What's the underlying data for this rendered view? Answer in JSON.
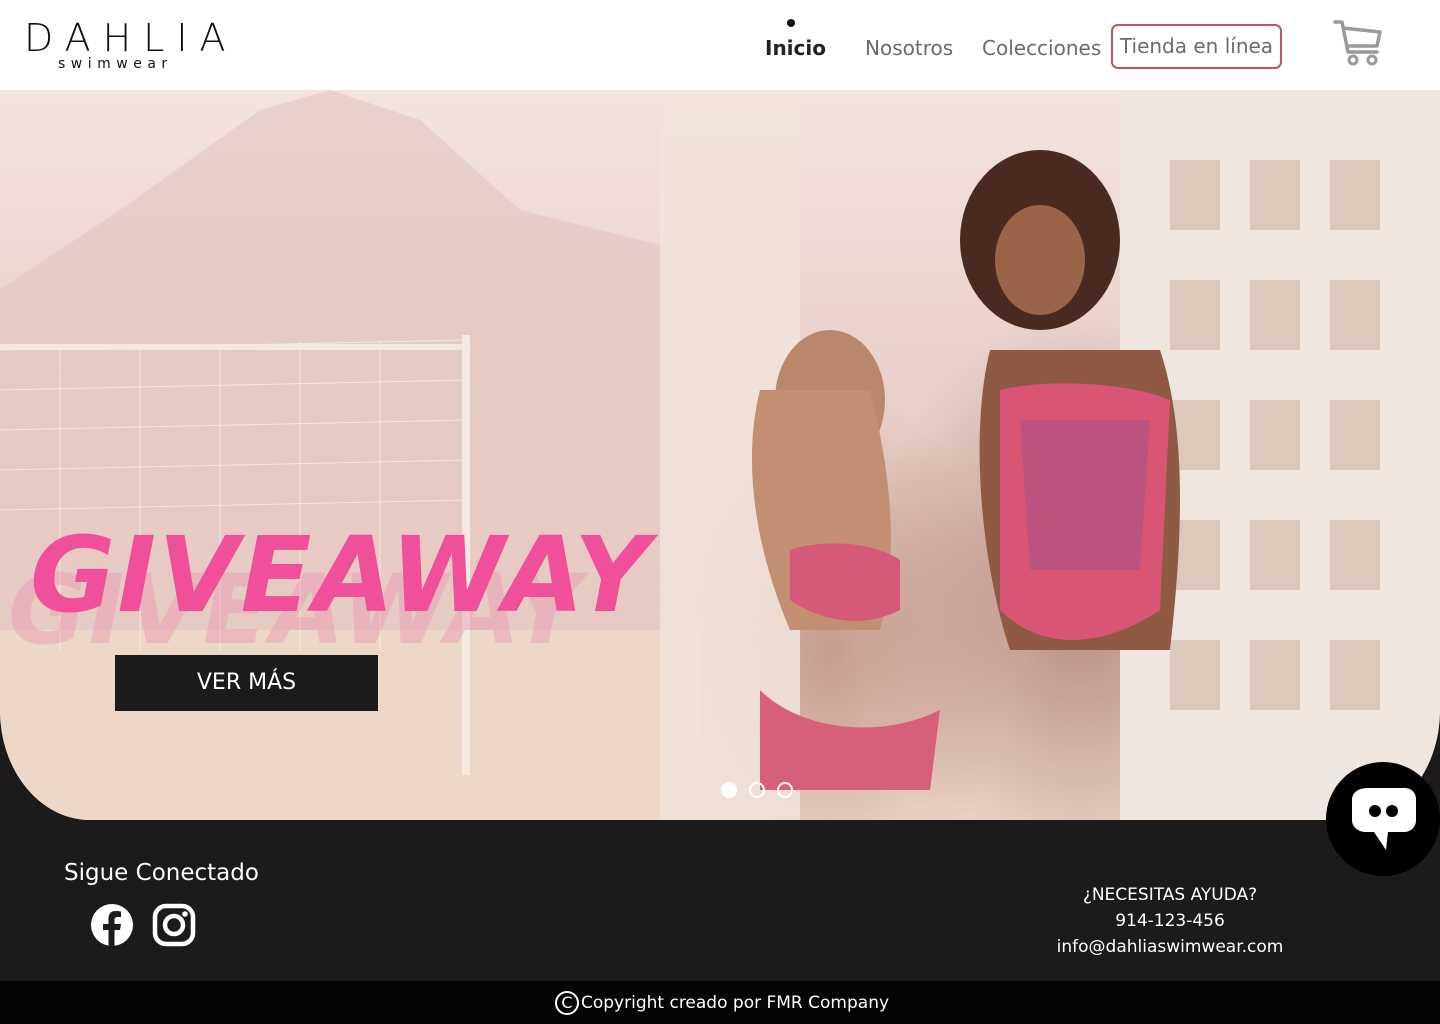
{
  "brand": {
    "name": "DAHLIA",
    "tagline": "swimwear"
  },
  "nav": {
    "items": [
      {
        "label": "Inicio",
        "active": true
      },
      {
        "label": "Nosotros",
        "active": false
      },
      {
        "label": "Colecciones",
        "active": false
      }
    ],
    "shop_button": "Tienda en línea",
    "cart_icon": "cart-icon"
  },
  "hero": {
    "headline": "GIVEAWAY",
    "cta_label": "VER MÁS",
    "slides_count": 3,
    "active_slide": 1,
    "headline_color": "#f0509a"
  },
  "chat": {
    "icon": "chat-bubble-icon"
  },
  "footer": {
    "social_title": "Sigue Conectado",
    "social_icons": [
      "facebook-icon",
      "instagram-icon"
    ],
    "help_title": "¿NECESITAS AYUDA?",
    "phone": "914-123-456",
    "email": "info@dahliaswimwear.com",
    "copyright": "Copyright creado por FMR Company"
  },
  "colors": {
    "accent": "#c4545a",
    "dark": "#1c1a1b",
    "pink": "#f0509a"
  }
}
